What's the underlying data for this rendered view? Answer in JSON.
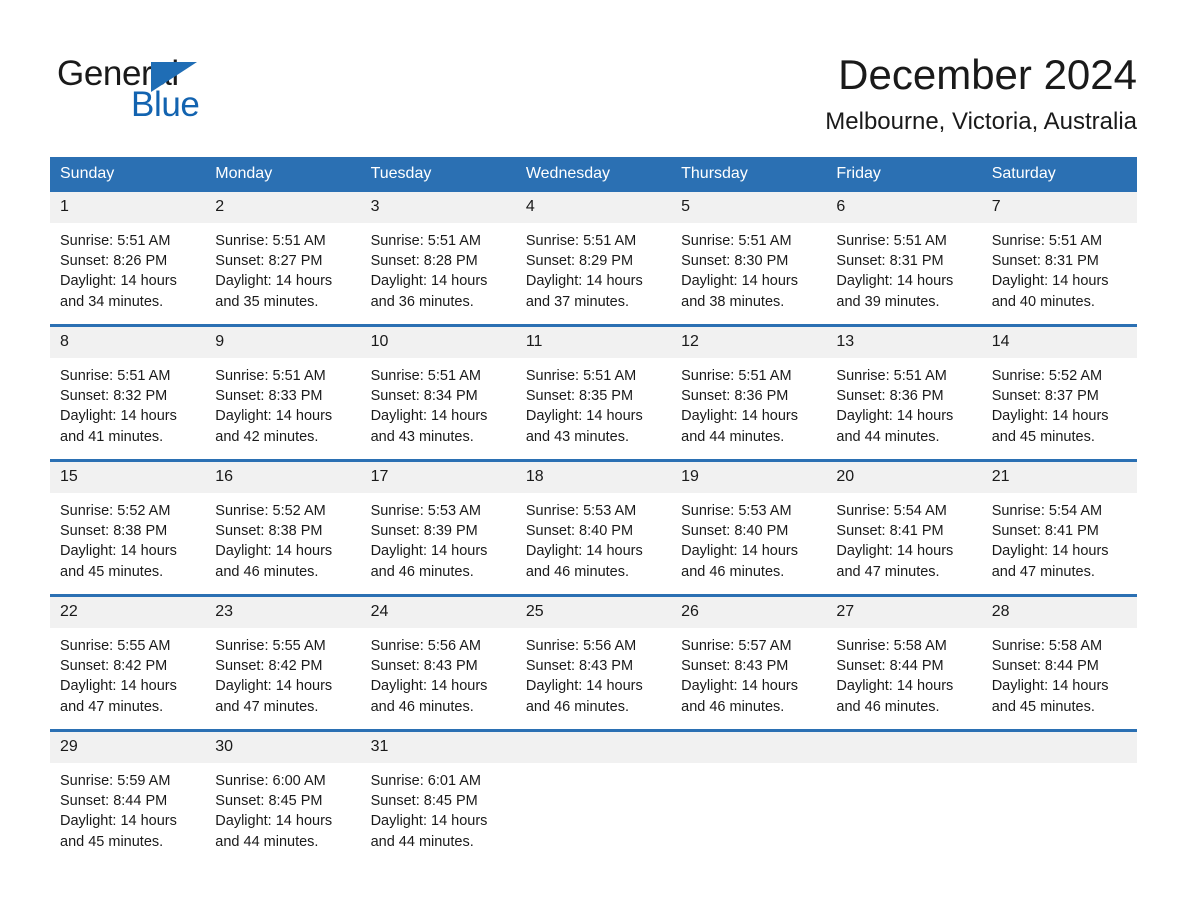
{
  "brand": {
    "name_part1": "General",
    "name_part2": "Blue",
    "triangle_color": "#1f6db5",
    "blue_color": "#1263b0"
  },
  "header": {
    "title": "December 2024",
    "location": "Melbourne, Victoria, Australia"
  },
  "theme": {
    "header_bg": "#2b70b3",
    "row_divider": "#2b70b3",
    "daynum_bg": "#f1f1f1",
    "text": "#1a1a1a"
  },
  "calendar": {
    "weekday_headers": [
      "Sunday",
      "Monday",
      "Tuesday",
      "Wednesday",
      "Thursday",
      "Friday",
      "Saturday"
    ],
    "weeks": [
      [
        {
          "day": "1",
          "sunrise": "Sunrise: 5:51 AM",
          "sunset": "Sunset: 8:26 PM",
          "daylight": "Daylight: 14 hours and 34 minutes."
        },
        {
          "day": "2",
          "sunrise": "Sunrise: 5:51 AM",
          "sunset": "Sunset: 8:27 PM",
          "daylight": "Daylight: 14 hours and 35 minutes."
        },
        {
          "day": "3",
          "sunrise": "Sunrise: 5:51 AM",
          "sunset": "Sunset: 8:28 PM",
          "daylight": "Daylight: 14 hours and 36 minutes."
        },
        {
          "day": "4",
          "sunrise": "Sunrise: 5:51 AM",
          "sunset": "Sunset: 8:29 PM",
          "daylight": "Daylight: 14 hours and 37 minutes."
        },
        {
          "day": "5",
          "sunrise": "Sunrise: 5:51 AM",
          "sunset": "Sunset: 8:30 PM",
          "daylight": "Daylight: 14 hours and 38 minutes."
        },
        {
          "day": "6",
          "sunrise": "Sunrise: 5:51 AM",
          "sunset": "Sunset: 8:31 PM",
          "daylight": "Daylight: 14 hours and 39 minutes."
        },
        {
          "day": "7",
          "sunrise": "Sunrise: 5:51 AM",
          "sunset": "Sunset: 8:31 PM",
          "daylight": "Daylight: 14 hours and 40 minutes."
        }
      ],
      [
        {
          "day": "8",
          "sunrise": "Sunrise: 5:51 AM",
          "sunset": "Sunset: 8:32 PM",
          "daylight": "Daylight: 14 hours and 41 minutes."
        },
        {
          "day": "9",
          "sunrise": "Sunrise: 5:51 AM",
          "sunset": "Sunset: 8:33 PM",
          "daylight": "Daylight: 14 hours and 42 minutes."
        },
        {
          "day": "10",
          "sunrise": "Sunrise: 5:51 AM",
          "sunset": "Sunset: 8:34 PM",
          "daylight": "Daylight: 14 hours and 43 minutes."
        },
        {
          "day": "11",
          "sunrise": "Sunrise: 5:51 AM",
          "sunset": "Sunset: 8:35 PM",
          "daylight": "Daylight: 14 hours and 43 minutes."
        },
        {
          "day": "12",
          "sunrise": "Sunrise: 5:51 AM",
          "sunset": "Sunset: 8:36 PM",
          "daylight": "Daylight: 14 hours and 44 minutes."
        },
        {
          "day": "13",
          "sunrise": "Sunrise: 5:51 AM",
          "sunset": "Sunset: 8:36 PM",
          "daylight": "Daylight: 14 hours and 44 minutes."
        },
        {
          "day": "14",
          "sunrise": "Sunrise: 5:52 AM",
          "sunset": "Sunset: 8:37 PM",
          "daylight": "Daylight: 14 hours and 45 minutes."
        }
      ],
      [
        {
          "day": "15",
          "sunrise": "Sunrise: 5:52 AM",
          "sunset": "Sunset: 8:38 PM",
          "daylight": "Daylight: 14 hours and 45 minutes."
        },
        {
          "day": "16",
          "sunrise": "Sunrise: 5:52 AM",
          "sunset": "Sunset: 8:38 PM",
          "daylight": "Daylight: 14 hours and 46 minutes."
        },
        {
          "day": "17",
          "sunrise": "Sunrise: 5:53 AM",
          "sunset": "Sunset: 8:39 PM",
          "daylight": "Daylight: 14 hours and 46 minutes."
        },
        {
          "day": "18",
          "sunrise": "Sunrise: 5:53 AM",
          "sunset": "Sunset: 8:40 PM",
          "daylight": "Daylight: 14 hours and 46 minutes."
        },
        {
          "day": "19",
          "sunrise": "Sunrise: 5:53 AM",
          "sunset": "Sunset: 8:40 PM",
          "daylight": "Daylight: 14 hours and 46 minutes."
        },
        {
          "day": "20",
          "sunrise": "Sunrise: 5:54 AM",
          "sunset": "Sunset: 8:41 PM",
          "daylight": "Daylight: 14 hours and 47 minutes."
        },
        {
          "day": "21",
          "sunrise": "Sunrise: 5:54 AM",
          "sunset": "Sunset: 8:41 PM",
          "daylight": "Daylight: 14 hours and 47 minutes."
        }
      ],
      [
        {
          "day": "22",
          "sunrise": "Sunrise: 5:55 AM",
          "sunset": "Sunset: 8:42 PM",
          "daylight": "Daylight: 14 hours and 47 minutes."
        },
        {
          "day": "23",
          "sunrise": "Sunrise: 5:55 AM",
          "sunset": "Sunset: 8:42 PM",
          "daylight": "Daylight: 14 hours and 47 minutes."
        },
        {
          "day": "24",
          "sunrise": "Sunrise: 5:56 AM",
          "sunset": "Sunset: 8:43 PM",
          "daylight": "Daylight: 14 hours and 46 minutes."
        },
        {
          "day": "25",
          "sunrise": "Sunrise: 5:56 AM",
          "sunset": "Sunset: 8:43 PM",
          "daylight": "Daylight: 14 hours and 46 minutes."
        },
        {
          "day": "26",
          "sunrise": "Sunrise: 5:57 AM",
          "sunset": "Sunset: 8:43 PM",
          "daylight": "Daylight: 14 hours and 46 minutes."
        },
        {
          "day": "27",
          "sunrise": "Sunrise: 5:58 AM",
          "sunset": "Sunset: 8:44 PM",
          "daylight": "Daylight: 14 hours and 46 minutes."
        },
        {
          "day": "28",
          "sunrise": "Sunrise: 5:58 AM",
          "sunset": "Sunset: 8:44 PM",
          "daylight": "Daylight: 14 hours and 45 minutes."
        }
      ],
      [
        {
          "day": "29",
          "sunrise": "Sunrise: 5:59 AM",
          "sunset": "Sunset: 8:44 PM",
          "daylight": "Daylight: 14 hours and 45 minutes."
        },
        {
          "day": "30",
          "sunrise": "Sunrise: 6:00 AM",
          "sunset": "Sunset: 8:45 PM",
          "daylight": "Daylight: 14 hours and 44 minutes."
        },
        {
          "day": "31",
          "sunrise": "Sunrise: 6:01 AM",
          "sunset": "Sunset: 8:45 PM",
          "daylight": "Daylight: 14 hours and 44 minutes."
        },
        {
          "day": "",
          "sunrise": "",
          "sunset": "",
          "daylight": ""
        },
        {
          "day": "",
          "sunrise": "",
          "sunset": "",
          "daylight": ""
        },
        {
          "day": "",
          "sunrise": "",
          "sunset": "",
          "daylight": ""
        },
        {
          "day": "",
          "sunrise": "",
          "sunset": "",
          "daylight": ""
        }
      ]
    ]
  }
}
